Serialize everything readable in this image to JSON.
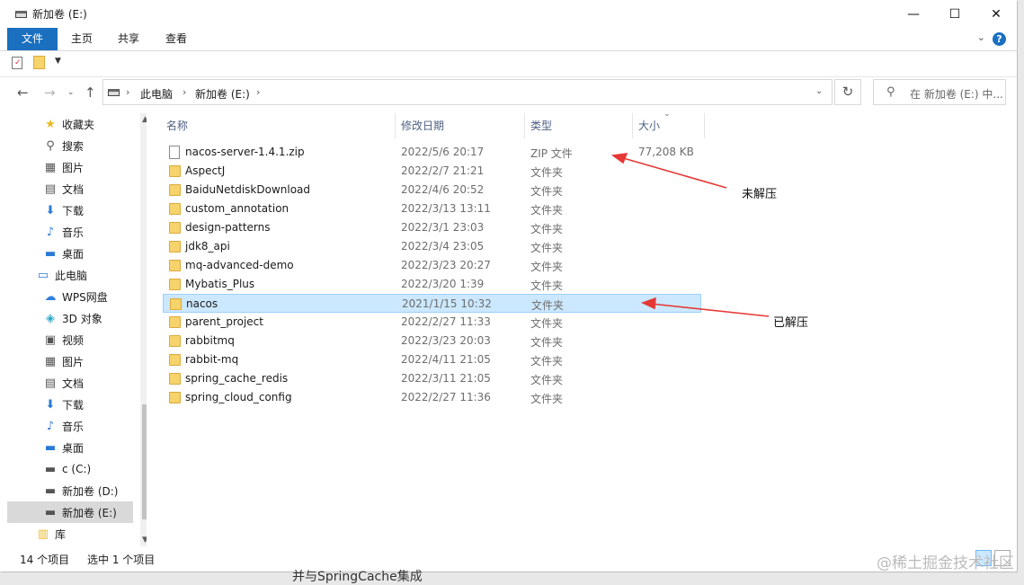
{
  "window": {
    "title": "新加卷 (E:)"
  },
  "ribbon": {
    "tabs": [
      "文件",
      "主页",
      "共享",
      "查看"
    ],
    "help": "?"
  },
  "address": {
    "segments": [
      "此电脑",
      "新加卷 (E:)"
    ]
  },
  "search": {
    "placeholder": "在 新加卷 (E:) 中..."
  },
  "sidebar": {
    "items": [
      {
        "label": "收藏夹",
        "icon": "star-icon"
      },
      {
        "label": "搜索",
        "icon": "search-icon"
      },
      {
        "label": "图片",
        "icon": "pictures-icon"
      },
      {
        "label": "文档",
        "icon": "documents-icon"
      },
      {
        "label": "下载",
        "icon": "download-icon"
      },
      {
        "label": "音乐",
        "icon": "music-icon"
      },
      {
        "label": "桌面",
        "icon": "desktop-icon"
      },
      {
        "label": "此电脑",
        "icon": "computer-icon"
      },
      {
        "label": "WPS网盘",
        "icon": "cloud-icon"
      },
      {
        "label": "3D 对象",
        "icon": "3d-objects-icon"
      },
      {
        "label": "视频",
        "icon": "video-icon"
      },
      {
        "label": "图片",
        "icon": "pictures-icon"
      },
      {
        "label": "文档",
        "icon": "documents-icon"
      },
      {
        "label": "下载",
        "icon": "download-icon"
      },
      {
        "label": "音乐",
        "icon": "music-icon"
      },
      {
        "label": "桌面",
        "icon": "desktop-icon"
      },
      {
        "label": "c (C:)",
        "icon": "drive-icon"
      },
      {
        "label": "新加卷 (D:)",
        "icon": "drive-icon"
      },
      {
        "label": "新加卷 (E:)",
        "icon": "drive-icon"
      },
      {
        "label": "库",
        "icon": "library-icon"
      }
    ],
    "selected": "新加卷 (E:)"
  },
  "columns": {
    "name": "名称",
    "date": "修改日期",
    "type": "类型",
    "size": "大小"
  },
  "files": [
    {
      "name": "nacos-server-1.4.1.zip",
      "date": "2022/5/6 20:17",
      "type": "ZIP 文件",
      "size": "77,208 KB",
      "kind": "zip"
    },
    {
      "name": "AspectJ",
      "date": "2022/2/7 21:21",
      "type": "文件夹",
      "size": "",
      "kind": "folder"
    },
    {
      "name": "BaiduNetdiskDownload",
      "date": "2022/4/6 20:52",
      "type": "文件夹",
      "size": "",
      "kind": "folder"
    },
    {
      "name": "custom_annotation",
      "date": "2022/3/13 13:11",
      "type": "文件夹",
      "size": "",
      "kind": "folder"
    },
    {
      "name": "design-patterns",
      "date": "2022/3/1 23:03",
      "type": "文件夹",
      "size": "",
      "kind": "folder"
    },
    {
      "name": "jdk8_api",
      "date": "2022/3/4 23:05",
      "type": "文件夹",
      "size": "",
      "kind": "folder"
    },
    {
      "name": "mq-advanced-demo",
      "date": "2022/3/23 20:27",
      "type": "文件夹",
      "size": "",
      "kind": "folder"
    },
    {
      "name": "Mybatis_Plus",
      "date": "2022/3/20 1:39",
      "type": "文件夹",
      "size": "",
      "kind": "folder"
    },
    {
      "name": "nacos",
      "date": "2021/1/15 10:32",
      "type": "文件夹",
      "size": "",
      "kind": "folder",
      "selected": true
    },
    {
      "name": "parent_project",
      "date": "2022/2/27 11:33",
      "type": "文件夹",
      "size": "",
      "kind": "folder"
    },
    {
      "name": "rabbitmq",
      "date": "2022/3/23 20:03",
      "type": "文件夹",
      "size": "",
      "kind": "folder"
    },
    {
      "name": "rabbit-mq",
      "date": "2022/4/11 21:05",
      "type": "文件夹",
      "size": "",
      "kind": "folder"
    },
    {
      "name": "spring_cache_redis",
      "date": "2022/3/11 21:05",
      "type": "文件夹",
      "size": "",
      "kind": "folder"
    },
    {
      "name": "spring_cloud_config",
      "date": "2022/2/27 11:36",
      "type": "文件夹",
      "size": "",
      "kind": "folder"
    }
  ],
  "status": {
    "count": "14 个项目",
    "selected": "选中 1 个项目"
  },
  "annotations": {
    "unzipped_no": "未解压",
    "unzipped_yes": "已解压"
  },
  "watermark": "@稀土掘金技术社区",
  "background_text": "并与SpringCache集成",
  "colors": {
    "accent": "#1a6fbf",
    "selection": "#cce8ff",
    "arrow": "#e53935"
  }
}
